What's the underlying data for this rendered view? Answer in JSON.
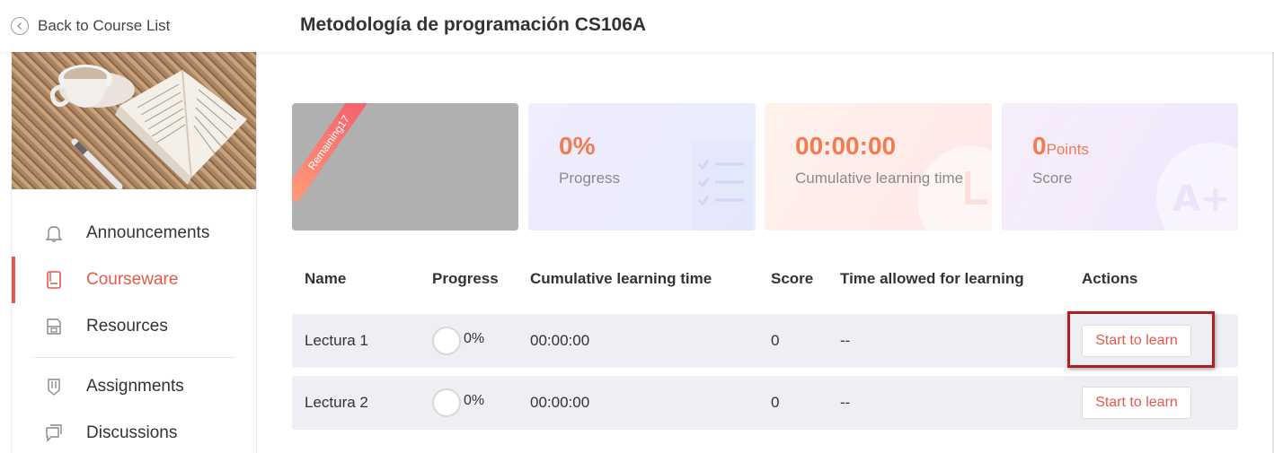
{
  "header": {
    "back_label": "Back to Course List",
    "course_title": "Metodología de programación CS106A"
  },
  "sidebar": {
    "items": [
      {
        "label": "Announcements",
        "icon": "bell-icon",
        "active": false
      },
      {
        "label": "Courseware",
        "icon": "book-icon",
        "active": true
      },
      {
        "label": "Resources",
        "icon": "folder-icon",
        "active": false
      },
      {
        "label": "Assignments",
        "icon": "pencil-icon",
        "active": false
      },
      {
        "label": "Discussions",
        "icon": "chat-icon",
        "active": false
      }
    ]
  },
  "stats": {
    "ribbon": "Remaining17",
    "progress": {
      "value": "0%",
      "label": "Progress"
    },
    "time": {
      "value": "00:00:00",
      "label": "Cumulative learning time"
    },
    "score": {
      "value": "0",
      "unit": "Points",
      "label": "Score"
    }
  },
  "table": {
    "headers": [
      "Name",
      "Progress",
      "Cumulative learning time",
      "Score",
      "Time allowed for learning",
      "Actions"
    ],
    "rows": [
      {
        "name": "Lectura 1",
        "progress": "0%",
        "time": "00:00:00",
        "score": "0",
        "allowed": "--",
        "action": "Start to learn"
      },
      {
        "name": "Lectura 2",
        "progress": "0%",
        "time": "00:00:00",
        "score": "0",
        "allowed": "--",
        "action": "Start to learn"
      }
    ]
  },
  "colors": {
    "accent": "#e35a4a",
    "stat_value": "#f07c52",
    "highlight_box": "#b01e22"
  }
}
